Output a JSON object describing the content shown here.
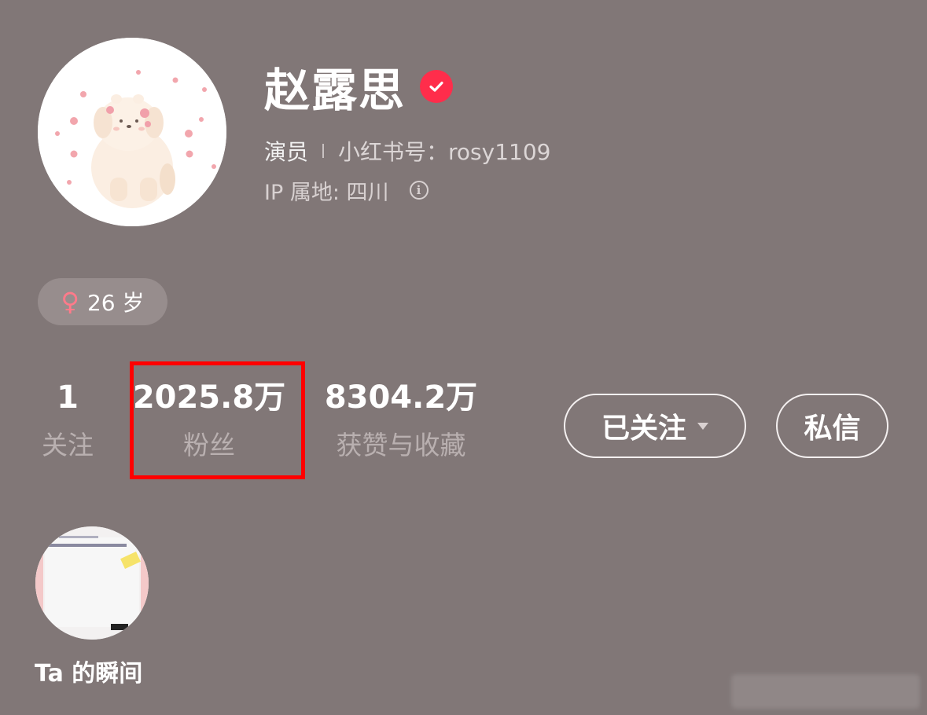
{
  "profile": {
    "name": "赵露思",
    "occupation": "演员",
    "redbook_id": "小红书号：rosy1109",
    "ip_location": "IP 属地: 四川",
    "tag_age": "26 岁"
  },
  "stats": {
    "following_count": "1",
    "following_label": "关注",
    "fans_count": "2025.8万",
    "fans_label": "粉丝",
    "likes_count": "8304.2万",
    "likes_label": "获赞与收藏"
  },
  "actions": {
    "following_button": "已关注",
    "message_button": "私信"
  },
  "moments": {
    "label": "Ta 的瞬间"
  },
  "colors": {
    "background": "#817777",
    "verified_badge": "#ff2d4b",
    "highlight_box": "#ff0000",
    "female_icon": "#ff7a8a"
  },
  "icons": {
    "verified": "verified-check-icon",
    "info": "info-circle-icon",
    "gender": "female-icon",
    "dropdown": "caret-down-icon"
  }
}
